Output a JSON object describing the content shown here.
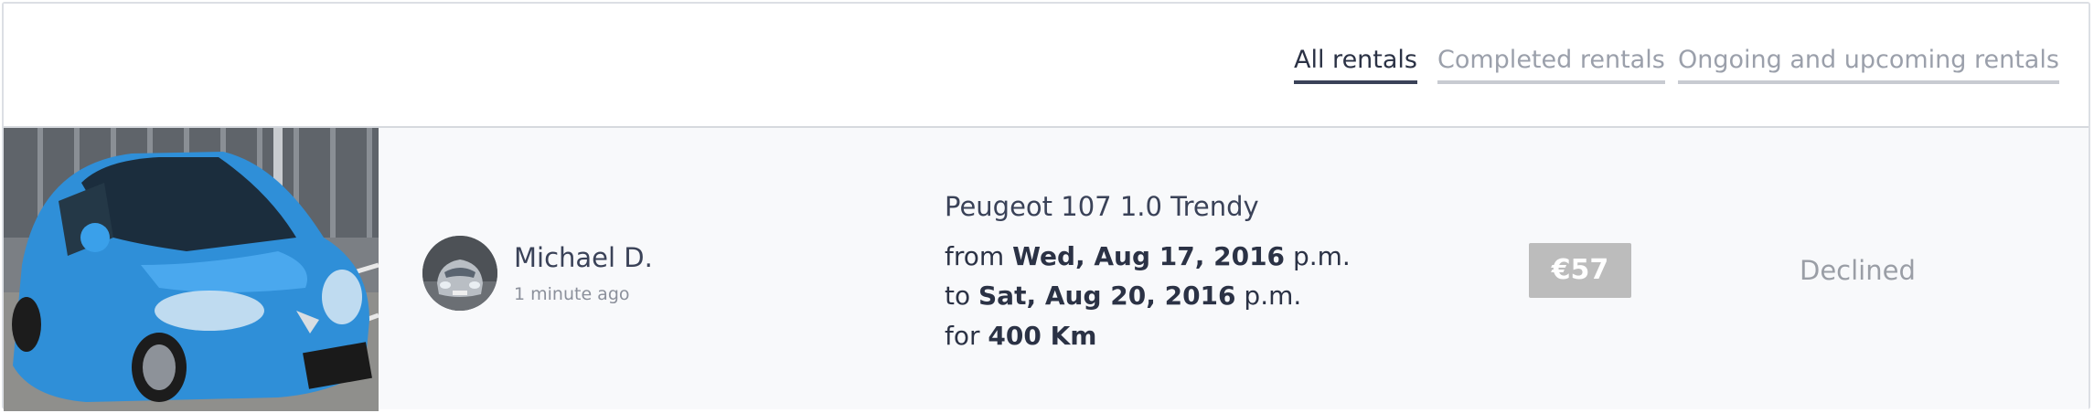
{
  "tabs": [
    {
      "label": "All rentals",
      "active": true
    },
    {
      "label": "Completed rentals",
      "active": false
    },
    {
      "label": "Ongoing and upcoming rentals",
      "active": false
    }
  ],
  "rental": {
    "owner": {
      "name": "Michael D.",
      "time_ago": "1 minute ago"
    },
    "car": {
      "title": "Peugeot 107 1.0 Trendy",
      "color": "#2f8fd8"
    },
    "from_prefix": "from ",
    "from_date": "Wed, Aug 17, 2016",
    "from_suffix": " p.m.",
    "to_prefix": "to ",
    "to_date": "Sat, Aug 20, 2016",
    "to_suffix": " p.m.",
    "for_prefix": "for ",
    "distance": "400 Km",
    "price": "€57",
    "status": "Declined"
  },
  "colors": {
    "text_dark": "#2b3245",
    "tab_inactive": "#9ba0ab",
    "price_badge": "#bcbcbc",
    "status": "#9a9ea6"
  }
}
